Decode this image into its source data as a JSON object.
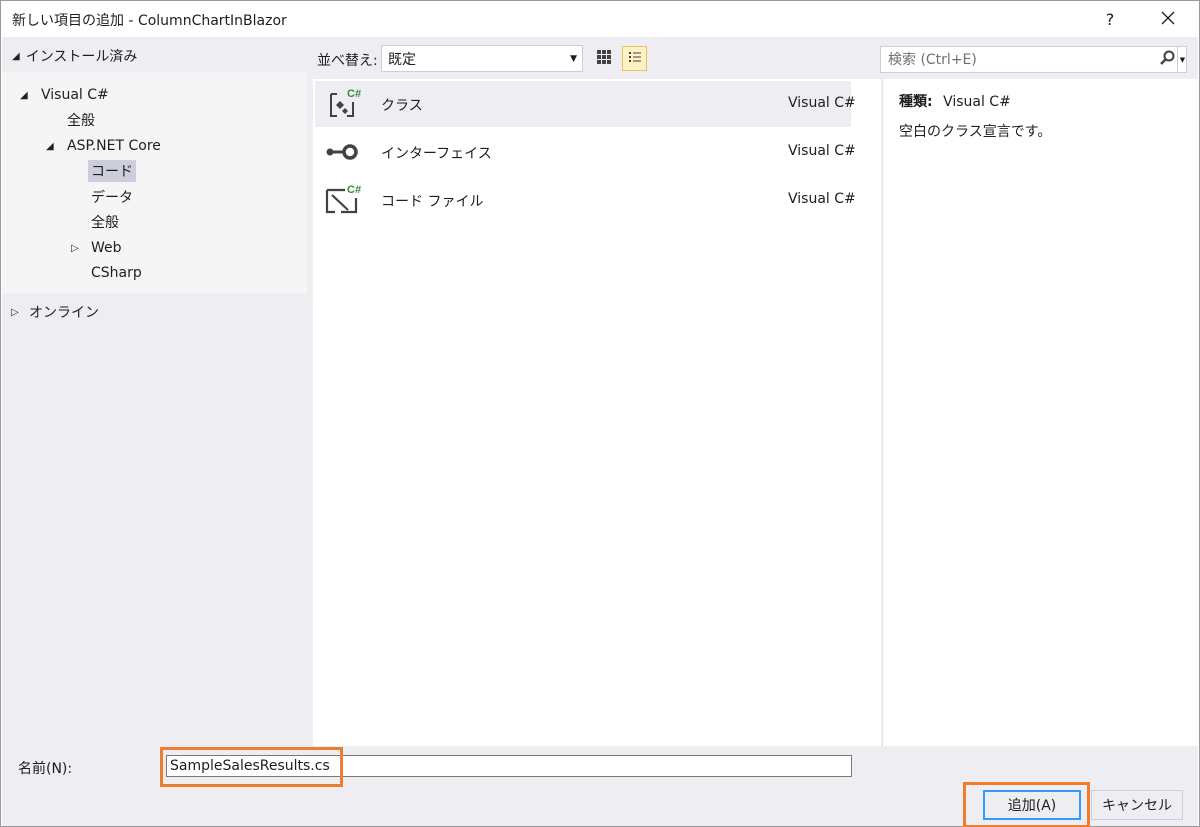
{
  "window": {
    "title": "新しい項目の追加 - ColumnChartInBlazor",
    "help_label": "?",
    "close_label": "✕"
  },
  "left_panel": {
    "installed_label": "インストール済み",
    "tree": [
      {
        "label": "Visual C#",
        "expanded": true
      },
      {
        "label": "全般"
      },
      {
        "label": "ASP.NET Core",
        "expanded": true
      },
      {
        "label": "コード",
        "selected": true
      },
      {
        "label": "データ"
      },
      {
        "label": "全般"
      },
      {
        "label": "Web",
        "expanded": false
      },
      {
        "label": "CSharp"
      }
    ],
    "online_label": "オンライン"
  },
  "toolbar": {
    "sort_label": "並べ替え:",
    "sort_value": "既定"
  },
  "search": {
    "placeholder": "検索 (Ctrl+E)"
  },
  "templates": [
    {
      "name": "クラス",
      "lang": "Visual C#",
      "icon": "class-icon",
      "selected": true
    },
    {
      "name": "インターフェイス",
      "lang": "Visual C#",
      "icon": "interface-icon"
    },
    {
      "name": "コード ファイル",
      "lang": "Visual C#",
      "icon": "code-file-icon"
    }
  ],
  "details": {
    "type_label": "種類:",
    "type_value": "Visual C#",
    "description": "空白のクラス宣言です。"
  },
  "bottom": {
    "name_label": "名前(N):",
    "name_value": "SampleSalesResults.cs",
    "add_label": "追加(A)",
    "cancel_label": "キャンセル"
  },
  "colors": {
    "highlight": "#ed7d31",
    "panel_bg": "#eeeef2",
    "selection": "#cccedb",
    "csharp_green": "#388a34"
  }
}
